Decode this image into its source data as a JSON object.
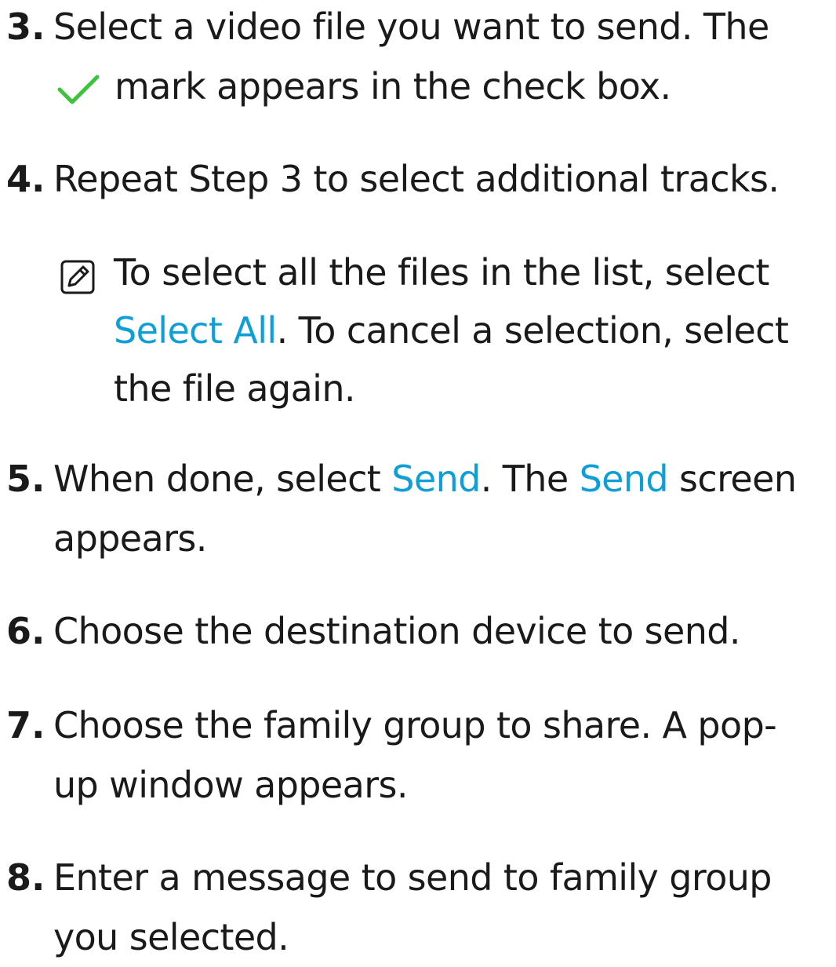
{
  "steps": [
    {
      "number": "3.",
      "line1": "Select a video file you want to send. The",
      "line2": "mark appears in the check box."
    },
    {
      "number": "4.",
      "line1": "Repeat Step 3 to select additional tracks."
    },
    {
      "number": "5.",
      "line1_a": "When done, select ",
      "line1_link1": "Send",
      "line1_b": ". The ",
      "line1_link2": "Send",
      "line1_c": " screen",
      "line2": "appears."
    },
    {
      "number": "6.",
      "line1": "Choose the destination device to send."
    },
    {
      "number": "7.",
      "line1": "Choose the family group to share. A pop-",
      "line2": "up window appears."
    },
    {
      "number": "8.",
      "line1": "Enter a message to send to family group",
      "line2": "you selected."
    }
  ],
  "note": {
    "line1": "To select all the files in the list, select",
    "line2_link": "Select All",
    "line2_rest": ". To cancel a selection, select",
    "line3": "the file again."
  },
  "icons": {
    "check": "checkmark-icon",
    "note": "note-pencil-icon"
  },
  "colors": {
    "link": "#0e9fd8",
    "check": "#3cc43c",
    "text": "#1a1a1a"
  }
}
